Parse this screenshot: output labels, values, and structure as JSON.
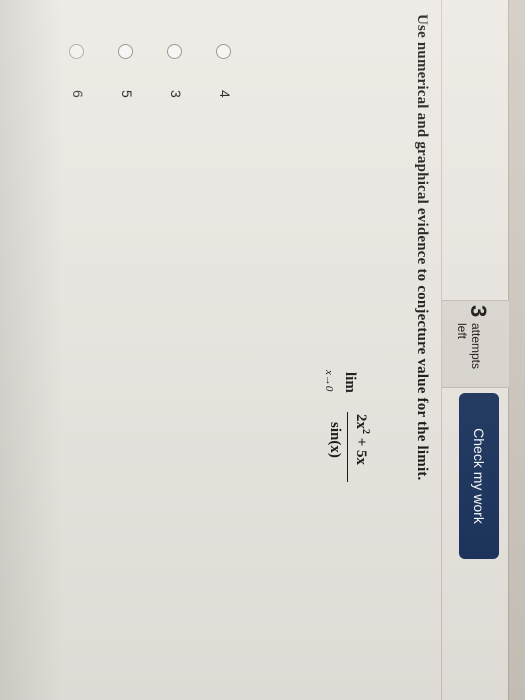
{
  "header": {
    "attempts_count": "3",
    "attempts_label": "attempts left",
    "check_button": "Check my work"
  },
  "question": {
    "prompt": "Use numerical and graphical evidence to conjecture value for the limit.",
    "limit": {
      "lim": "lim",
      "approach": "x→0",
      "numerator_base": "2x",
      "numerator_exponent": "2",
      "numerator_tail": " + 5x",
      "denominator": "sin(x)"
    }
  },
  "options": [
    {
      "label": "4"
    },
    {
      "label": "3"
    },
    {
      "label": "5"
    },
    {
      "label": "6"
    }
  ]
}
